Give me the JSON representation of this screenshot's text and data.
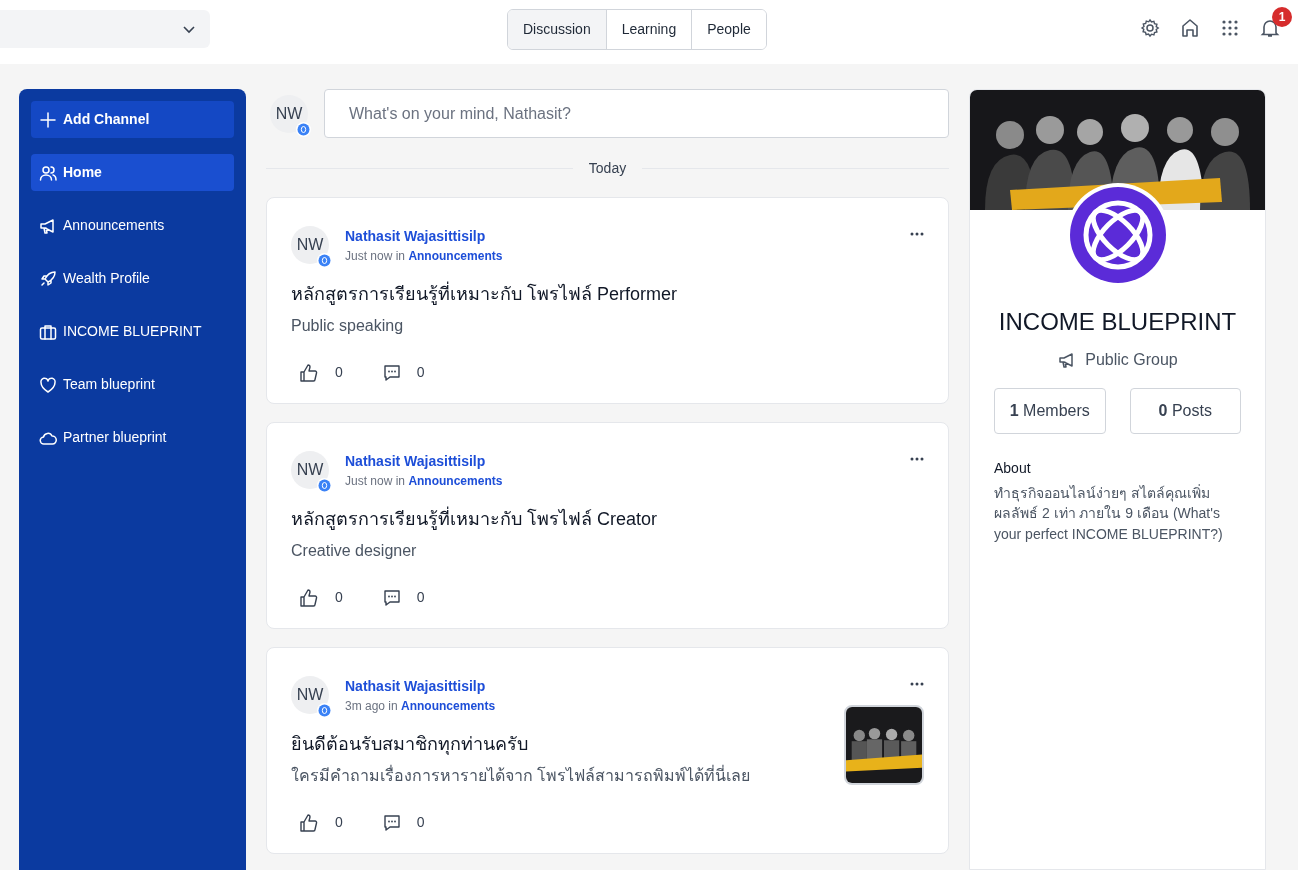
{
  "tabs": [
    {
      "label": "Discussion",
      "selected": true
    },
    {
      "label": "Learning",
      "selected": false
    },
    {
      "label": "People",
      "selected": false
    }
  ],
  "notifications": {
    "count": "1"
  },
  "sidebar": {
    "items": [
      {
        "kind": "button",
        "label": "Add Channel",
        "selected": false
      },
      {
        "kind": "channel",
        "label": "Home",
        "selected": true
      },
      {
        "kind": "channel",
        "label": "Announcements",
        "selected": false
      },
      {
        "kind": "channel",
        "label": "Wealth Profile",
        "selected": false
      },
      {
        "kind": "channel",
        "label": "INCOME BLUEPRINT",
        "selected": false
      },
      {
        "kind": "channel",
        "label": "Team blueprint",
        "selected": false
      },
      {
        "kind": "channel",
        "label": "Partner blueprint",
        "selected": false
      }
    ]
  },
  "composer": {
    "avatar": "NW",
    "placeholder": "What's on your mind, Nathasit?"
  },
  "divider": "Today",
  "posts": [
    {
      "avatar": "NW",
      "author": "Nathasit Wajasittisilp",
      "time": "Just now",
      "in": "in",
      "channel": "Announcements",
      "title": "หลักสูตรการเรียนรู้ที่เหมาะกับ โพรไฟล์ Performer",
      "body": "Public speaking",
      "likes": "0",
      "comments": "0",
      "has_image": false
    },
    {
      "avatar": "NW",
      "author": "Nathasit Wajasittisilp",
      "time": "Just now",
      "in": "in",
      "channel": "Announcements",
      "title": "หลักสูตรการเรียนรู้ที่เหมาะกับ โพรไฟล์ Creator",
      "body": "Creative designer",
      "likes": "0",
      "comments": "0",
      "has_image": false
    },
    {
      "avatar": "NW",
      "author": "Nathasit Wajasittisilp",
      "time": "3m ago",
      "in": "in",
      "channel": "Announcements",
      "title": "ยินดีต้อนรับสมาชิกทุกท่านครับ",
      "body": "ใครมีคำถามเรื่องการหารายได้จาก โพรไฟล์สามารถพิมพ์ได้ที่นี่เลย",
      "likes": "0",
      "comments": "0",
      "has_image": true
    }
  ],
  "group": {
    "name": "INCOME BLUEPRINT",
    "type": "Public Group",
    "members_count": "1",
    "members_label": "Members",
    "posts_count": "0",
    "posts_label": "Posts",
    "about_title": "About",
    "about": "ทำธุรกิจออนไลน์ง่ายๆ สไตล์คุณเพิ่มผลลัพธ์ 2 เท่า ภายใน 9 เดือน (What's your perfect INCOME BLUEPRINT?)"
  }
}
